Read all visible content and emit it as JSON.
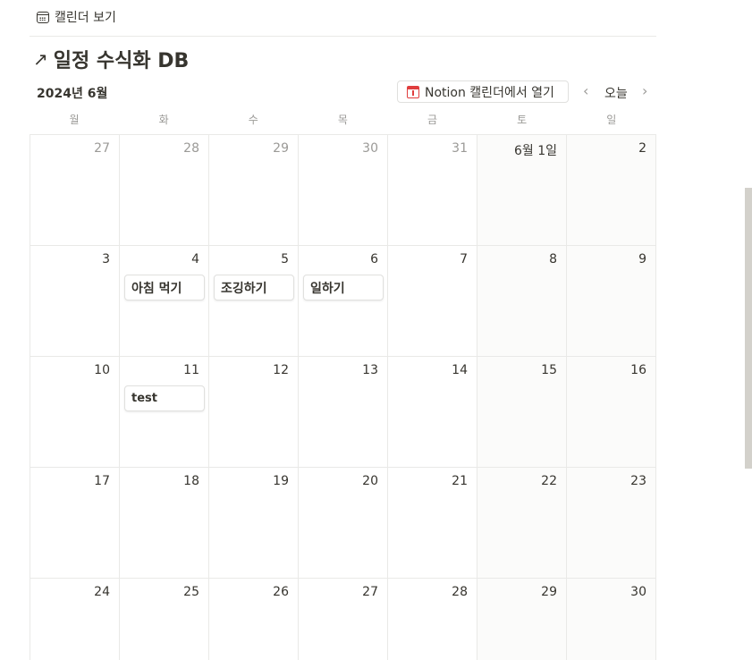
{
  "view": {
    "tab_label": "캘린더 보기",
    "icon": "calendar-icon"
  },
  "page": {
    "title": "일정 수식화 DB",
    "title_icon": "arrow-up-right-icon"
  },
  "toolbar": {
    "month": "2024년 6월",
    "open_calendar_label": "Notion 캘린더에서 열기",
    "open_calendar_icon": "notion-calendar-icon",
    "today_label": "오늘",
    "prev_icon": "chevron-left-icon",
    "next_icon": "chevron-right-icon"
  },
  "weekdays": [
    "월",
    "화",
    "수",
    "목",
    "금",
    "토",
    "일"
  ],
  "weeks": [
    {
      "days": [
        {
          "label": "27",
          "dim": true
        },
        {
          "label": "28",
          "dim": true
        },
        {
          "label": "29",
          "dim": true
        },
        {
          "label": "30",
          "dim": true
        },
        {
          "label": "31",
          "dim": true
        },
        {
          "label": "6월 1일",
          "dim": false
        },
        {
          "label": "2",
          "dim": false
        }
      ]
    },
    {
      "days": [
        {
          "label": "3"
        },
        {
          "label": "4",
          "event": "아침 먹기"
        },
        {
          "label": "5",
          "event": "조깅하기"
        },
        {
          "label": "6",
          "event": "일하기"
        },
        {
          "label": "7"
        },
        {
          "label": "8"
        },
        {
          "label": "9"
        }
      ]
    },
    {
      "days": [
        {
          "label": "10"
        },
        {
          "label": "11",
          "event": "test"
        },
        {
          "label": "12"
        },
        {
          "label": "13"
        },
        {
          "label": "14"
        },
        {
          "label": "15"
        },
        {
          "label": "16"
        }
      ]
    },
    {
      "days": [
        {
          "label": "17"
        },
        {
          "label": "18"
        },
        {
          "label": "19"
        },
        {
          "label": "20"
        },
        {
          "label": "21"
        },
        {
          "label": "22"
        },
        {
          "label": "23"
        }
      ]
    },
    {
      "days": [
        {
          "label": "24"
        },
        {
          "label": "25"
        },
        {
          "label": "26"
        },
        {
          "label": "27"
        },
        {
          "label": "28"
        },
        {
          "label": "29"
        },
        {
          "label": "30"
        }
      ]
    }
  ],
  "colors": {
    "text": "#37352f",
    "muted": "#9b9a97",
    "border": "#e9e9e7",
    "weekend_bg": "#fbfbfa",
    "accent_red": "#e03e3e",
    "scrollbar": "#d3d1cb"
  }
}
